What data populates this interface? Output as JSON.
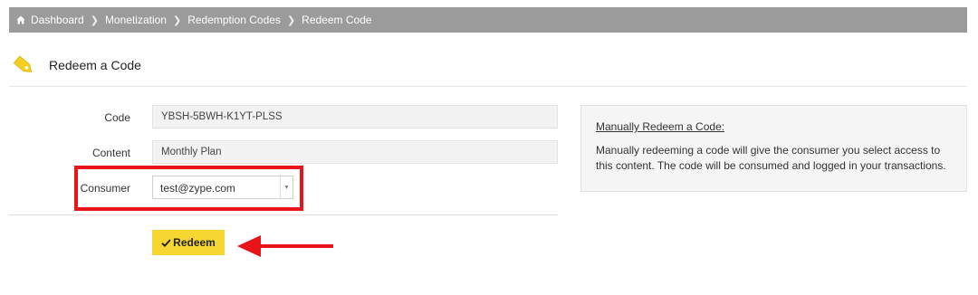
{
  "breadcrumb": {
    "items": [
      "Dashboard",
      "Monetization",
      "Redemption Codes",
      "Redeem Code"
    ]
  },
  "header": {
    "title": "Redeem a Code",
    "icon": "tag-icon"
  },
  "form": {
    "code_label": "Code",
    "code_value": "YBSH-5BWH-K1YT-PLSS",
    "content_label": "Content",
    "content_value": "Monthly Plan",
    "consumer_label": "Consumer",
    "consumer_value": "test@zype.com"
  },
  "actions": {
    "redeem_label": "Redeem"
  },
  "info": {
    "title": "Manually Redeem a Code:",
    "text": "Manually redeeming a code will give the consumer you select access to this content. The code will be consumed and logged in your transactions."
  },
  "colors": {
    "breadcrumb_bg": "#9b9b9b",
    "accent_yellow": "#f6d630",
    "annotation_red": "#e8141a"
  }
}
